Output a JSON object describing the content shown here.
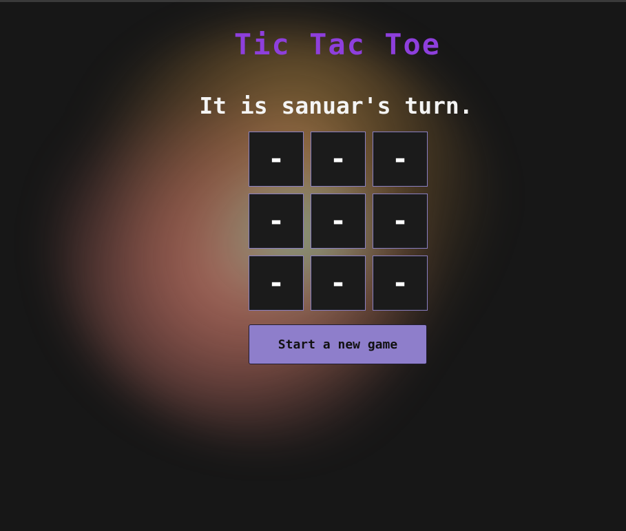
{
  "game": {
    "title": "Tic Tac Toe",
    "status": "It is sanuar's turn.",
    "board": [
      "-",
      "-",
      "-",
      "-",
      "-",
      "-",
      "-",
      "-",
      "-"
    ],
    "new_game_label": "Start a new game"
  },
  "colors": {
    "background": "#171717",
    "title": "#8e3fdc",
    "status": "#f4f4f4",
    "cell_border": "#8a80c4",
    "button": "#8e7ecb"
  }
}
